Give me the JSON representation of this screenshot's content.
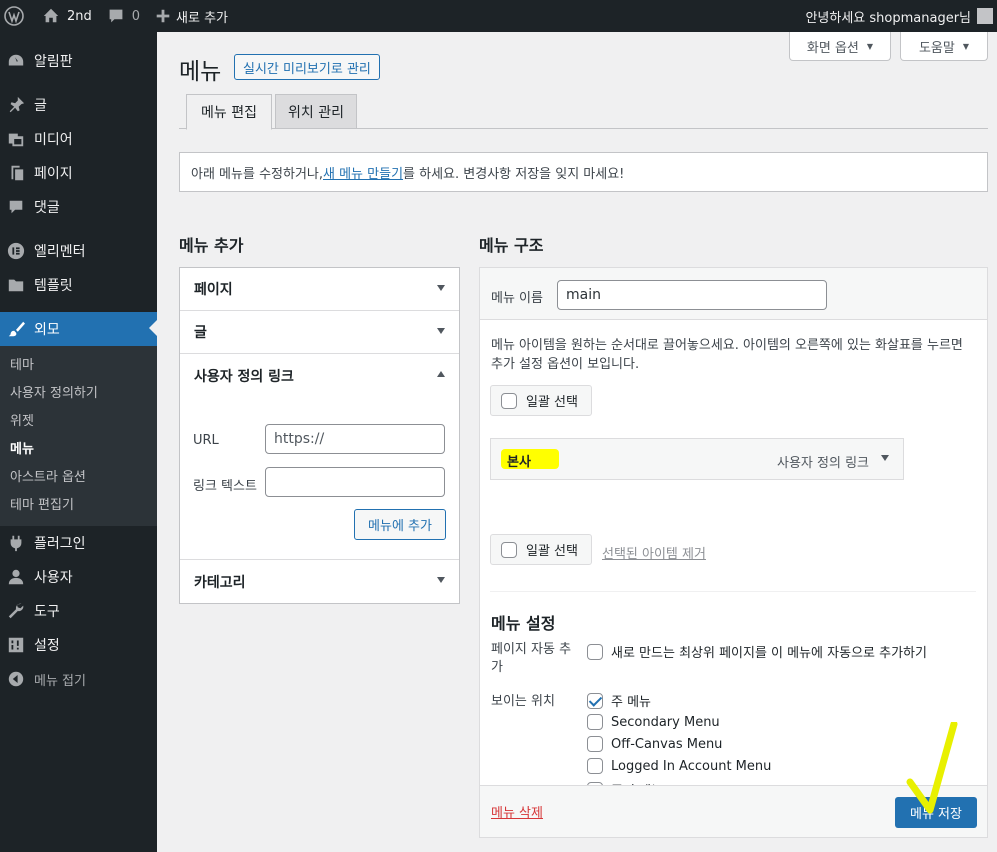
{
  "adminbar": {
    "site_name": "2nd",
    "comments_count": "0",
    "new_label": "새로 추가",
    "greeting": "안녕하세요 shopmanager님"
  },
  "sidebar": {
    "items": [
      {
        "label": "알림판",
        "icon": "dashboard-icon"
      },
      {
        "label": "글",
        "icon": "pin-icon"
      },
      {
        "label": "미디어",
        "icon": "media-icon"
      },
      {
        "label": "페이지",
        "icon": "page-icon"
      },
      {
        "label": "댓글",
        "icon": "comment-icon"
      },
      {
        "label": "엘리멘터",
        "icon": "elementor-icon"
      },
      {
        "label": "템플릿",
        "icon": "folder-icon"
      },
      {
        "label": "외모",
        "icon": "brush-icon"
      },
      {
        "label": "플러그인",
        "icon": "plugin-icon"
      },
      {
        "label": "사용자",
        "icon": "user-icon"
      },
      {
        "label": "도구",
        "icon": "wrench-icon"
      },
      {
        "label": "설정",
        "icon": "settings-icon"
      },
      {
        "label": "메뉴 접기",
        "icon": "collapse-icon"
      }
    ],
    "appearance_sub": [
      "테마",
      "사용자 정의하기",
      "위젯",
      "메뉴",
      "아스트라 옵션",
      "테마 편집기"
    ]
  },
  "screen_options": "화면 옵션",
  "help": "도움말",
  "page_title": "메뉴",
  "live_preview": "실시간 미리보기로 관리",
  "tabs": [
    "메뉴 편집",
    "위치 관리"
  ],
  "notice": {
    "before": "아래 메뉴를 수정하거나, ",
    "link": "새 메뉴 만들기",
    "after": "를 하세요. 변경사항 저장을 잊지 마세요!"
  },
  "add_menu": {
    "title": "메뉴 추가",
    "sections": [
      "페이지",
      "글",
      "사용자 정의 링크",
      "카테고리"
    ],
    "custom_link": {
      "url_label": "URL",
      "url_placeholder": "https://",
      "text_label": "링크 텍스트",
      "text_value": "",
      "add_button": "메뉴에 추가"
    }
  },
  "structure": {
    "title": "메뉴 구조",
    "name_label": "메뉴 이름",
    "name_value": "main",
    "instructions": "메뉴 아이템을 원하는 순서대로 끌어놓으세요. 아이템의 오른쪽에 있는 화살표를 누르면 추가 설정 옵션이 보입니다.",
    "bulk_select": "일괄 선택",
    "item": {
      "title": "본사",
      "type": "사용자 정의 링크"
    },
    "remove_selected": "선택된 아이템 제거",
    "settings_title": "메뉴 설정",
    "auto_add_label": "페이지 자동 추가",
    "auto_add_text": "새로 만드는 최상위 페이지를 이 메뉴에 자동으로 추가하기",
    "locations_label": "보이는 위치",
    "locations": [
      {
        "label": "주 메뉴",
        "checked": true
      },
      {
        "label": "Secondary Menu",
        "checked": false
      },
      {
        "label": "Off-Canvas Menu",
        "checked": false
      },
      {
        "label": "Logged In Account Menu",
        "checked": false
      },
      {
        "label": "푸터 메뉴",
        "checked": false
      }
    ],
    "delete_menu": "메뉴 삭제",
    "save_menu": "메뉴 저장"
  },
  "colors": {
    "accent": "#2271b1",
    "highlight": "#ffff00",
    "admin_bar": "#1d2327"
  }
}
